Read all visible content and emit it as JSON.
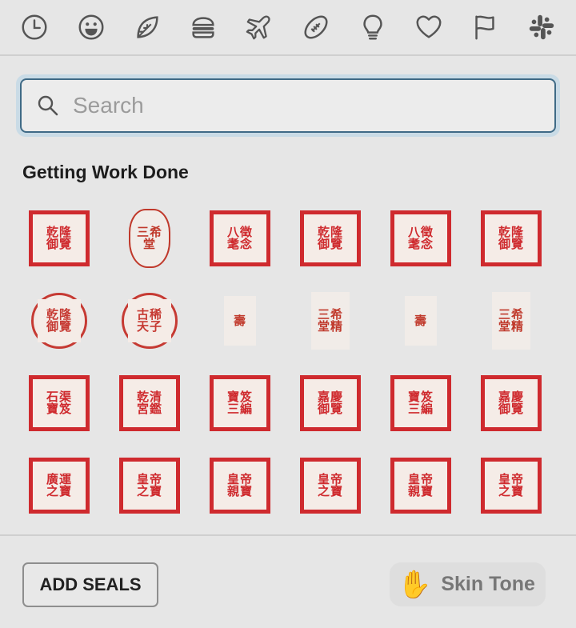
{
  "categories": [
    {
      "name": "recent",
      "icon": "clock-icon"
    },
    {
      "name": "smileys",
      "icon": "smiley-icon"
    },
    {
      "name": "nature",
      "icon": "leaf-icon"
    },
    {
      "name": "food",
      "icon": "burger-icon"
    },
    {
      "name": "travel",
      "icon": "airplane-icon"
    },
    {
      "name": "activity",
      "icon": "football-icon"
    },
    {
      "name": "objects",
      "icon": "lightbulb-icon"
    },
    {
      "name": "symbols",
      "icon": "heart-icon"
    },
    {
      "name": "flags",
      "icon": "flag-icon"
    },
    {
      "name": "custom",
      "icon": "slack-logo-icon"
    }
  ],
  "search": {
    "placeholder": "Search",
    "value": ""
  },
  "section": {
    "title": "Getting Work Done"
  },
  "seals": [
    {
      "style": "square",
      "glyph": "乾隆\n御覽"
    },
    {
      "style": "gourd",
      "glyph": "三希\n堂"
    },
    {
      "style": "square",
      "glyph": "八徵\n耄念"
    },
    {
      "style": "square",
      "glyph": "乾隆\n御覽"
    },
    {
      "style": "square",
      "glyph": "八徵\n耄念"
    },
    {
      "style": "square",
      "glyph": "乾隆\n御覽"
    },
    {
      "style": "round",
      "glyph": "乾隆\n御覽"
    },
    {
      "style": "round",
      "glyph": "古稀\n天子"
    },
    {
      "style": "oval",
      "glyph": "壽"
    },
    {
      "style": "plain",
      "glyph": "三希\n堂精"
    },
    {
      "style": "oval",
      "glyph": "壽"
    },
    {
      "style": "plain",
      "glyph": "三希\n堂精"
    },
    {
      "style": "square",
      "glyph": "石渠\n寶笈"
    },
    {
      "style": "square",
      "glyph": "乾清\n宮鑑"
    },
    {
      "style": "square",
      "glyph": "寶笈\n三編"
    },
    {
      "style": "square",
      "glyph": "嘉慶\n御覽"
    },
    {
      "style": "square",
      "glyph": "寶笈\n三編"
    },
    {
      "style": "square",
      "glyph": "嘉慶\n御覽"
    },
    {
      "style": "square",
      "glyph": "廣運\n之寶"
    },
    {
      "style": "square",
      "glyph": "皇帝\n之寶"
    },
    {
      "style": "square",
      "glyph": "皇帝\n親寶"
    },
    {
      "style": "square",
      "glyph": "皇帝\n之寶"
    },
    {
      "style": "square",
      "glyph": "皇帝\n親寶"
    },
    {
      "style": "square",
      "glyph": "皇帝\n之寶"
    }
  ],
  "footer": {
    "add_label": "ADD SEALS",
    "skin_label": "Skin Tone",
    "skin_emoji": "✋"
  },
  "colors": {
    "seal_red": "#cf2a2e",
    "focus_ring": "#c9dbe6",
    "border": "#3f6a86"
  }
}
